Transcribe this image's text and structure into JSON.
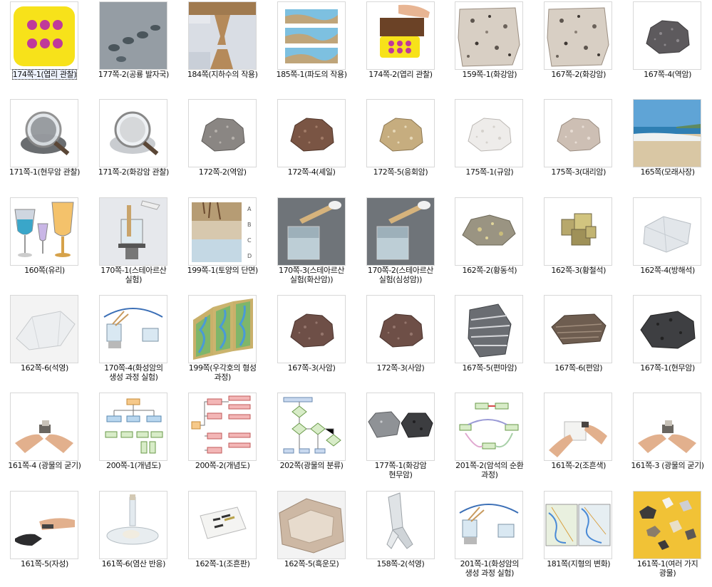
{
  "gallery": {
    "items": [
      {
        "caption": "174쪽-1(엽리 관찰)",
        "thumb": "dice-clay",
        "selected": true
      },
      {
        "caption": "177쪽-2(공룡 발자국)",
        "thumb": "footprints"
      },
      {
        "caption": "184쪽(지하수의 작용)",
        "thumb": "cave-diagram"
      },
      {
        "caption": "185쪽-1(파도의 작용)",
        "thumb": "wave-diagram"
      },
      {
        "caption": "174쪽-2(엽리 관찰)",
        "thumb": "hand-press"
      },
      {
        "caption": "159쪽-1(화강암)",
        "thumb": "granite"
      },
      {
        "caption": "167쪽-2(화강암)",
        "thumb": "granite"
      },
      {
        "caption": "167쪽-4(역암)",
        "thumb": "rock-dark"
      },
      {
        "caption": "171쪽-1(현무암 관찰)",
        "thumb": "magnifier-dark"
      },
      {
        "caption": "171쪽-2(화강암 관찰)",
        "thumb": "magnifier-light"
      },
      {
        "caption": "172쪽-2(역암)",
        "thumb": "rock-gray"
      },
      {
        "caption": "172쪽-4(셰일)",
        "thumb": "rock-brown"
      },
      {
        "caption": "172쪽-5(응회암)",
        "thumb": "rock-tan"
      },
      {
        "caption": "175쪽-1(규암)",
        "thumb": "rock-white"
      },
      {
        "caption": "175쪽-3(대리암)",
        "thumb": "rock-pink"
      },
      {
        "caption": "165쪽(모래사장)",
        "thumb": "beach"
      },
      {
        "caption": "160쪽(유리)",
        "thumb": "glasses"
      },
      {
        "caption": "170쪽-1(스테아르산\n실험)",
        "thumb": "lab-stand"
      },
      {
        "caption": "199쪽-1(토양의 단면)",
        "thumb": "soil"
      },
      {
        "caption": "170쪽-3(스테아르산\n실험(화산암))",
        "thumb": "beaker-dark"
      },
      {
        "caption": "170쪽-2(스테아르산\n실험(심성암))",
        "thumb": "beaker-dark"
      },
      {
        "caption": "162쪽-2(황동석)",
        "thumb": "mineral-gold"
      },
      {
        "caption": "162쪽-3(황철석)",
        "thumb": "pyrite"
      },
      {
        "caption": "162쪽-4(방해석)",
        "thumb": "calcite"
      },
      {
        "caption": "162쪽-6(석영)",
        "thumb": "quartz"
      },
      {
        "caption": "170쪽-4(화성암의\n생성 과정 실험)",
        "thumb": "experiment-diagram"
      },
      {
        "caption": "199쪽(우각호의 형성\n과정)",
        "thumb": "oxbow"
      },
      {
        "caption": "167쪽-3(사암)",
        "thumb": "rock-redbrown"
      },
      {
        "caption": "172쪽-3(사암)",
        "thumb": "rock-redbrown"
      },
      {
        "caption": "167쪽-5(편마암)",
        "thumb": "gneiss"
      },
      {
        "caption": "167쪽-6(편암)",
        "thumb": "schist"
      },
      {
        "caption": "167쪽-1(현무암)",
        "thumb": "basalt"
      },
      {
        "caption": "161쪽-4 (광물의 굳기)",
        "thumb": "hands-scratch"
      },
      {
        "caption": "200쪽-1(개념도)",
        "thumb": "concept-map"
      },
      {
        "caption": "200쪽-2(개념도)",
        "thumb": "concept-map-2"
      },
      {
        "caption": "202쪽(광물의 분류)",
        "thumb": "flowchart"
      },
      {
        "caption": "177쪽-1(화강암\n현무암)",
        "thumb": "two-rocks"
      },
      {
        "caption": "201쪽-2(암석의 순환\n과정)",
        "thumb": "rock-cycle"
      },
      {
        "caption": "161쪽-2(조흔색)",
        "thumb": "hands-streak"
      },
      {
        "caption": "161쪽-3 (광물의 굳기)",
        "thumb": "hands-scratch"
      },
      {
        "caption": "161쪽-5(자성)",
        "thumb": "magnet"
      },
      {
        "caption": "161쪽-6(염산 반응)",
        "thumb": "acid-dish"
      },
      {
        "caption": "162쪽-1(조흔판)",
        "thumb": "streak-plate"
      },
      {
        "caption": "162쪽-5(흑운모)",
        "thumb": "mica"
      },
      {
        "caption": "158쪽-2(석영)",
        "thumb": "crystal-clear"
      },
      {
        "caption": "201쪽-1(화성암의\n생성 과정 실험)",
        "thumb": "experiment-diagram"
      },
      {
        "caption": "181쪽(지형의 변화)",
        "thumb": "maps"
      },
      {
        "caption": "161쪽-1(여러 가지\n광물)",
        "thumb": "minerals-yellow"
      }
    ]
  }
}
